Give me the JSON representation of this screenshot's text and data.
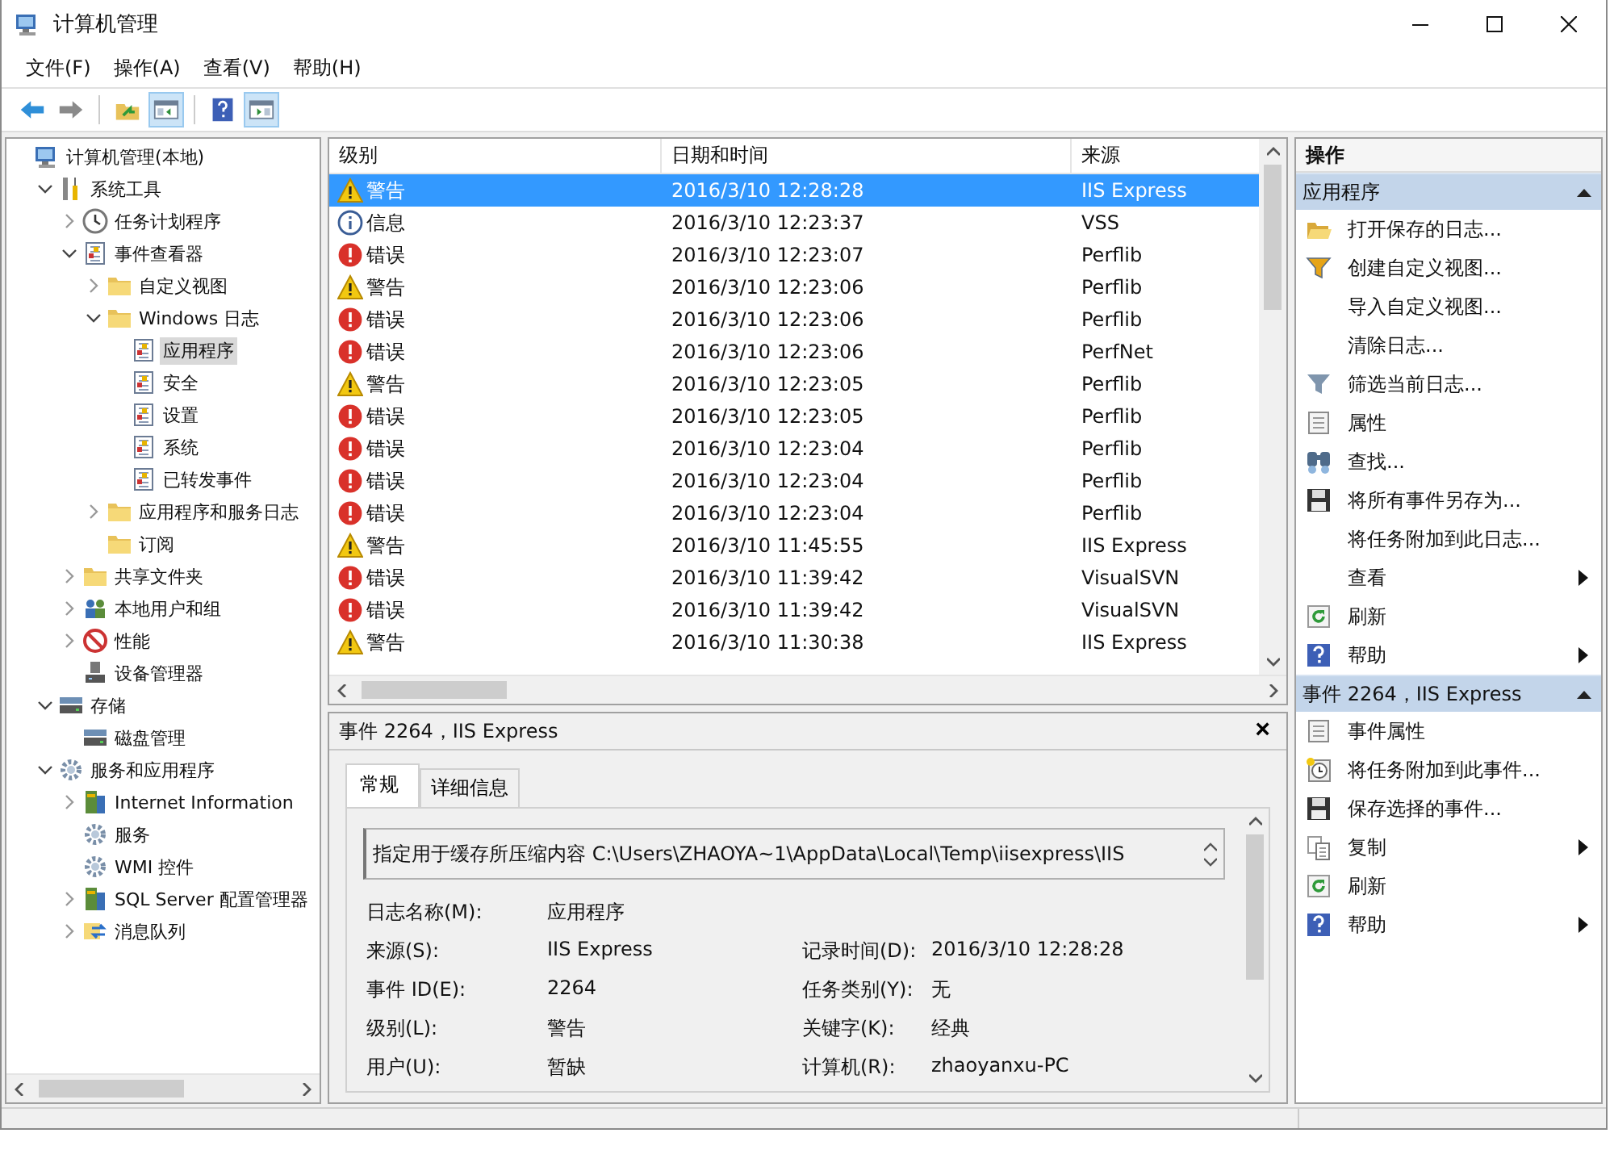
{
  "window": {
    "title": "计算机管理"
  },
  "menu": [
    "文件(F)",
    "操作(A)",
    "查看(V)",
    "帮助(H)"
  ],
  "toolbar": [
    {
      "pressed": false
    },
    {
      "pressed": false
    },
    {
      "pressed": false
    },
    {
      "pressed": true
    },
    {
      "pressed": false
    },
    {
      "pressed": true
    }
  ],
  "tree": [
    {
      "label": "计算机管理(本地)",
      "selected": false,
      "children": [
        {
          "label": "系统工具",
          "selected": false,
          "expanded": true,
          "children": [
            {
              "label": "任务计划程序",
              "selected": false,
              "expanded": false
            },
            {
              "label": "事件查看器",
              "selected": false,
              "expanded": true,
              "children": [
                {
                  "label": "自定义视图",
                  "selected": false,
                  "expanded": false
                },
                {
                  "label": "Windows 日志",
                  "selected": false,
                  "expanded": true,
                  "children": [
                    {
                      "label": "应用程序",
                      "selected": true
                    },
                    {
                      "label": "安全",
                      "selected": false
                    },
                    {
                      "label": "设置",
                      "selected": false
                    },
                    {
                      "label": "系统",
                      "selected": false
                    },
                    {
                      "label": "已转发事件",
                      "selected": false
                    }
                  ]
                },
                {
                  "label": "应用程序和服务日志",
                  "selected": false,
                  "expanded": false
                },
                {
                  "label": "订阅",
                  "selected": false
                }
              ]
            },
            {
              "label": "共享文件夹",
              "selected": false,
              "expanded": false
            },
            {
              "label": "本地用户和组",
              "selected": false,
              "expanded": false
            },
            {
              "label": "性能",
              "selected": false,
              "expanded": false
            },
            {
              "label": "设备管理器",
              "selected": false
            }
          ]
        },
        {
          "label": "存储",
          "selected": false,
          "expanded": true,
          "children": [
            {
              "label": "磁盘管理",
              "selected": false
            }
          ]
        },
        {
          "label": "服务和应用程序",
          "selected": false,
          "expanded": true,
          "children": [
            {
              "label": "Internet Information",
              "selected": false,
              "expanded": false
            },
            {
              "label": "服务",
              "selected": false
            },
            {
              "label": "WMI 控件",
              "selected": false
            },
            {
              "label": "SQL Server 配置管理器",
              "selected": false,
              "expanded": false
            },
            {
              "label": "消息队列",
              "selected": false,
              "expanded": false
            }
          ]
        }
      ]
    }
  ],
  "events": {
    "columns": [
      "级别",
      "日期和时间",
      "来源"
    ],
    "rows": [
      {
        "kind": "warning",
        "level": "警告",
        "datetime": "2016/3/10 12:28:28",
        "source": "IIS Express",
        "selected": true
      },
      {
        "kind": "info",
        "level": "信息",
        "datetime": "2016/3/10 12:23:37",
        "source": "VSS",
        "selected": false
      },
      {
        "kind": "error",
        "level": "错误",
        "datetime": "2016/3/10 12:23:07",
        "source": "Perflib",
        "selected": false
      },
      {
        "kind": "warning",
        "level": "警告",
        "datetime": "2016/3/10 12:23:06",
        "source": "Perflib",
        "selected": false
      },
      {
        "kind": "error",
        "level": "错误",
        "datetime": "2016/3/10 12:23:06",
        "source": "Perflib",
        "selected": false
      },
      {
        "kind": "error",
        "level": "错误",
        "datetime": "2016/3/10 12:23:06",
        "source": "PerfNet",
        "selected": false
      },
      {
        "kind": "warning",
        "level": "警告",
        "datetime": "2016/3/10 12:23:05",
        "source": "Perflib",
        "selected": false
      },
      {
        "kind": "error",
        "level": "错误",
        "datetime": "2016/3/10 12:23:05",
        "source": "Perflib",
        "selected": false
      },
      {
        "kind": "error",
        "level": "错误",
        "datetime": "2016/3/10 12:23:04",
        "source": "Perflib",
        "selected": false
      },
      {
        "kind": "error",
        "level": "错误",
        "datetime": "2016/3/10 12:23:04",
        "source": "Perflib",
        "selected": false
      },
      {
        "kind": "error",
        "level": "错误",
        "datetime": "2016/3/10 12:23:04",
        "source": "Perflib",
        "selected": false
      },
      {
        "kind": "warning",
        "level": "警告",
        "datetime": "2016/3/10 11:45:55",
        "source": "IIS Express",
        "selected": false
      },
      {
        "kind": "error",
        "level": "错误",
        "datetime": "2016/3/10 11:39:42",
        "source": "VisualSVN",
        "selected": false
      },
      {
        "kind": "error",
        "level": "错误",
        "datetime": "2016/3/10 11:39:42",
        "source": "VisualSVN",
        "selected": false
      },
      {
        "kind": "warning",
        "level": "警告",
        "datetime": "2016/3/10 11:30:38",
        "source": "IIS Express",
        "selected": false
      }
    ]
  },
  "detail": {
    "title": "事件 2264，IIS Express",
    "close": "×",
    "tabs": [
      {
        "label": "常规",
        "selected": true
      },
      {
        "label": "详细信息",
        "selected": false
      }
    ],
    "description": "指定用于缓存所压缩内容 C:\\Users\\ZHAOYA~1\\AppData\\Local\\Temp\\iisexpress\\IIS",
    "fields": [
      [
        {
          "label": "日志名称(M):",
          "value": "应用程序"
        }
      ],
      [
        {
          "label": "来源(S):",
          "value": "IIS Express"
        },
        {
          "label": "记录时间(D):",
          "value": "2016/3/10 12:28:28"
        }
      ],
      [
        {
          "label": "事件 ID(E):",
          "value": "2264"
        },
        {
          "label": "任务类别(Y):",
          "value": "无"
        }
      ],
      [
        {
          "label": "级别(L):",
          "value": "警告"
        },
        {
          "label": "关键字(K):",
          "value": "经典"
        }
      ],
      [
        {
          "label": "用户(U):",
          "value": "暂缺"
        },
        {
          "label": "计算机(R):",
          "value": "zhaoyanxu-PC"
        }
      ]
    ]
  },
  "actions": {
    "title": "操作",
    "sections": [
      {
        "title": "应用程序",
        "expanded": true,
        "items": [
          {
            "label": "打开保存的日志...",
            "submenu": false
          },
          {
            "label": "创建自定义视图...",
            "submenu": false
          },
          {
            "label": "导入自定义视图...",
            "submenu": false
          },
          {
            "label": "清除日志...",
            "submenu": false
          },
          {
            "label": "筛选当前日志...",
            "submenu": false
          },
          {
            "label": "属性",
            "submenu": false
          },
          {
            "label": "查找...",
            "submenu": false
          },
          {
            "label": "将所有事件另存为...",
            "submenu": false
          },
          {
            "label": "将任务附加到此日志...",
            "submenu": false
          },
          {
            "label": "查看",
            "submenu": true
          },
          {
            "label": "刷新",
            "submenu": false
          },
          {
            "label": "帮助",
            "submenu": true
          }
        ]
      },
      {
        "title": "事件 2264，IIS Express",
        "expanded": true,
        "items": [
          {
            "label": "事件属性",
            "submenu": false
          },
          {
            "label": "将任务附加到此事件...",
            "submenu": false
          },
          {
            "label": "保存选择的事件...",
            "submenu": false
          },
          {
            "label": "复制",
            "submenu": true
          },
          {
            "label": "刷新",
            "submenu": false
          },
          {
            "label": "帮助",
            "submenu": true
          }
        ]
      }
    ]
  }
}
